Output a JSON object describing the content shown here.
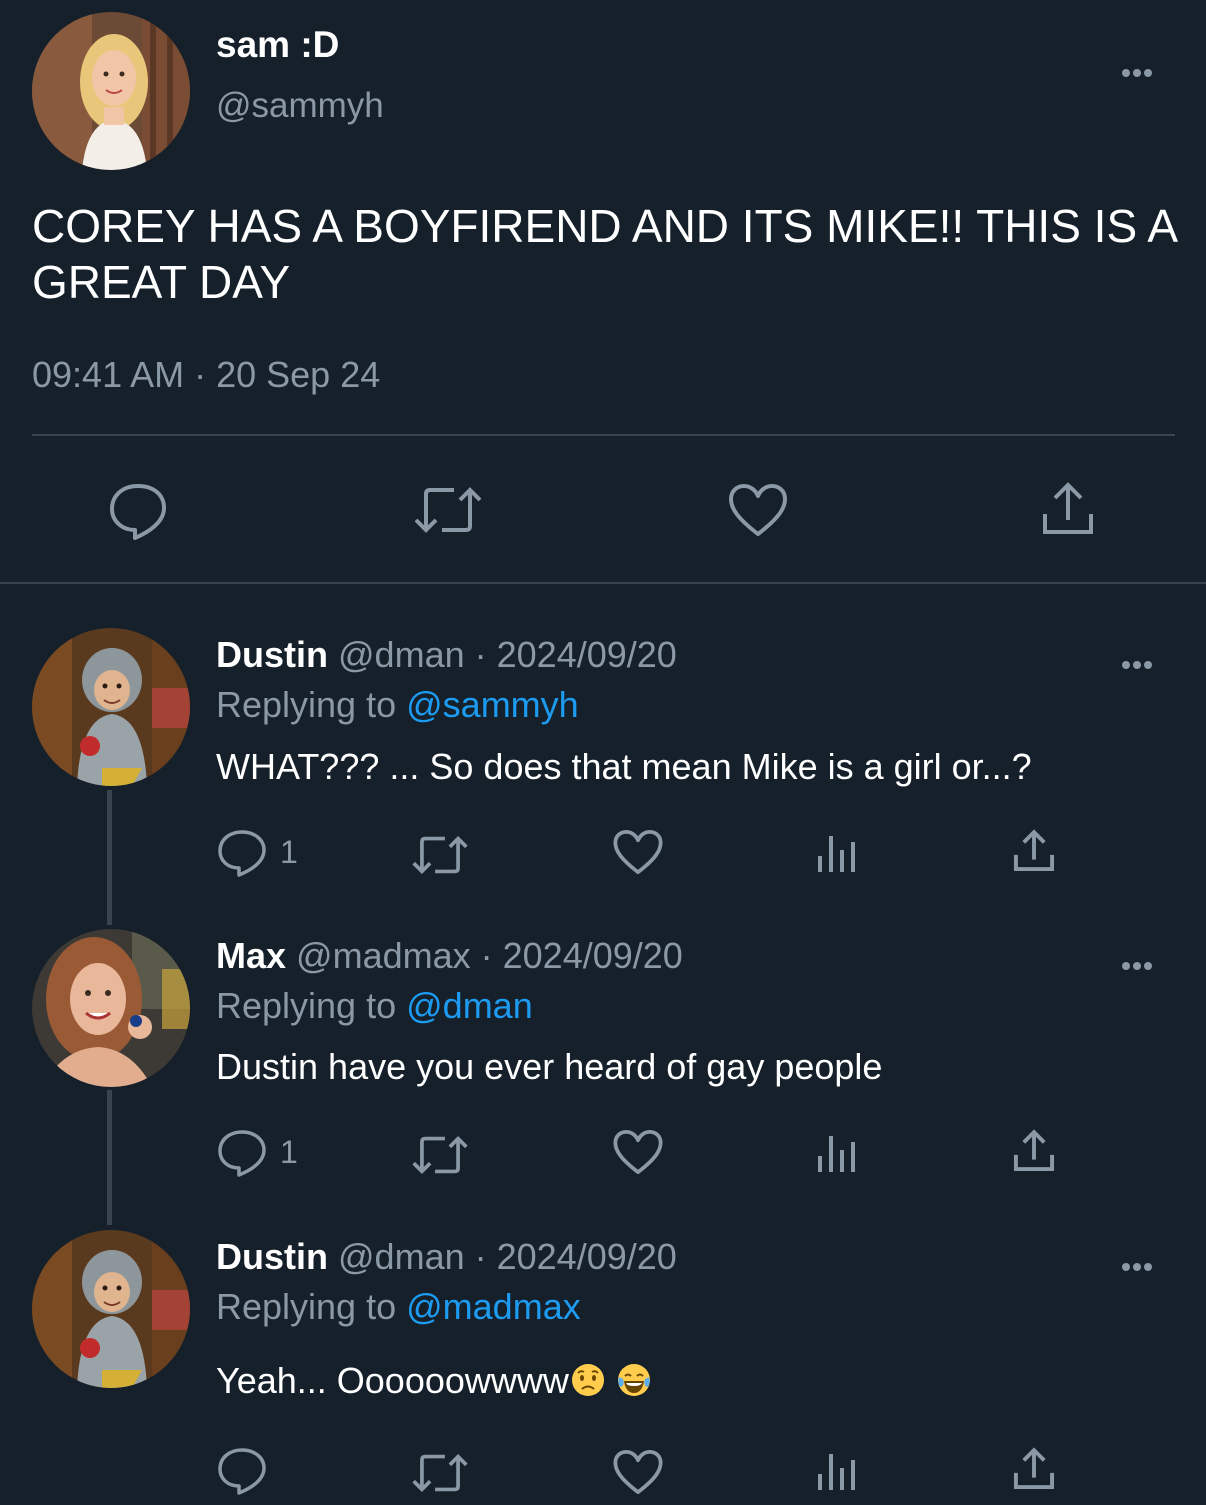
{
  "main_tweet": {
    "display_name": "sam :D",
    "handle": "@sammyh",
    "text": "COREY HAS A BOYFIREND AND ITS MIKE!! THIS IS A GREAT DAY",
    "timestamp": "09:41 AM · 20 Sep 24",
    "actions": [
      "reply-icon",
      "retweet-icon",
      "like-icon",
      "share-icon"
    ]
  },
  "replies": [
    {
      "display_name": "Dustin",
      "handle_date": "@dman · 2024/09/20",
      "replying_prefix": "Replying to",
      "replying_to": "@sammyh",
      "text": "WHAT??? ...  So does that mean Mike is a girl or...?",
      "reply_count": "1"
    },
    {
      "display_name": "Max",
      "handle_date": "@madmax · 2024/09/20",
      "replying_prefix": "Replying to",
      "replying_to": "@dman",
      "text": "Dustin have you ever heard of gay people",
      "reply_count": "1"
    },
    {
      "display_name": "Dustin",
      "handle_date": "@dman · 2024/09/20",
      "replying_prefix": "Replying to",
      "replying_to": "@madmax",
      "text": "Yeah... Oooooowwww",
      "emojis": [
        "worried-face-emoji",
        "tears-of-joy-emoji"
      ],
      "reply_count": ""
    }
  ],
  "colors": {
    "background": "#15202b",
    "secondary_text": "#8b98a5",
    "link": "#1d9bf0",
    "divider": "#38444d"
  }
}
